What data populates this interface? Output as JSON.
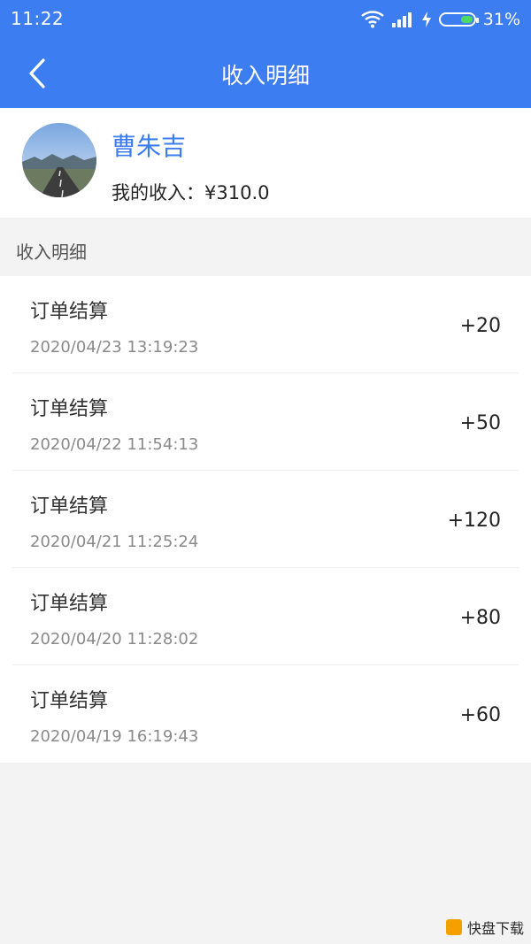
{
  "status": {
    "time": "11:22",
    "battery_percent": "31%"
  },
  "nav": {
    "title": "收入明细",
    "back_icon": "chevron-left-icon"
  },
  "profile": {
    "name": "曹朱吉",
    "income_label": "我的收入：",
    "income_value": "¥310.0"
  },
  "section": {
    "title": "收入明细"
  },
  "income_list": [
    {
      "title": "订单结算",
      "date": "2020/04/23 13:19:23",
      "amount": "+20"
    },
    {
      "title": "订单结算",
      "date": "2020/04/22 11:54:13",
      "amount": "+50"
    },
    {
      "title": "订单结算",
      "date": "2020/04/21 11:25:24",
      "amount": "+120"
    },
    {
      "title": "订单结算",
      "date": "2020/04/20 11:28:02",
      "amount": "+80"
    },
    {
      "title": "订单结算",
      "date": "2020/04/19 16:19:43",
      "amount": "+60"
    }
  ],
  "watermark": {
    "text": "快盘下载"
  },
  "colors": {
    "primary": "#3d7df2",
    "background": "#f3f3f3"
  }
}
